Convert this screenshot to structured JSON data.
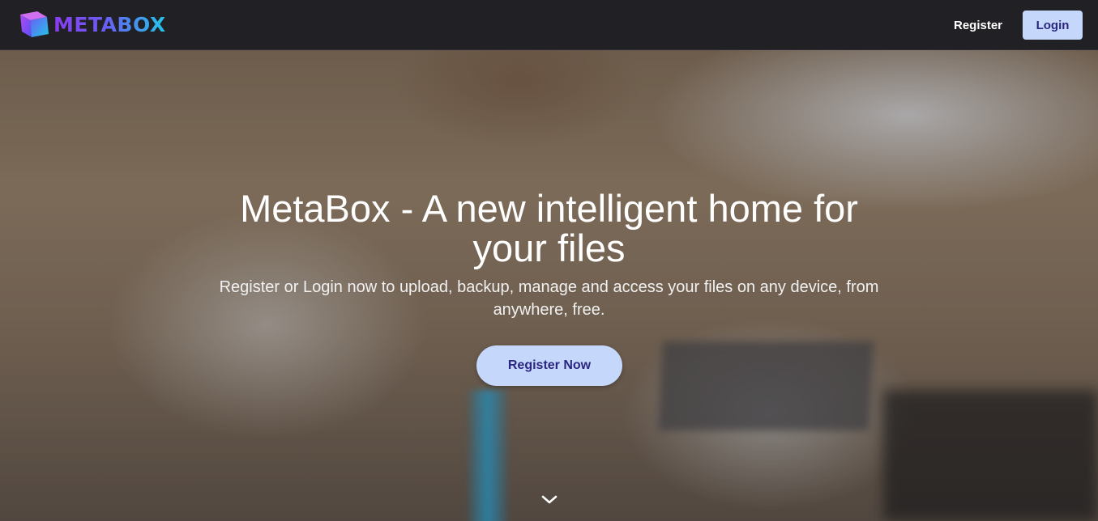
{
  "brand": {
    "name": "METABOX",
    "logo_icon": "cube-icon",
    "colors": [
      "#8a3cf0",
      "#22c6e8"
    ]
  },
  "nav": {
    "register_label": "Register",
    "login_label": "Login"
  },
  "hero": {
    "title": "MetaBox - A new intelligent home for your files",
    "subtitle": "Register or Login now to upload, backup, manage and access your files on any device, from anywhere, free.",
    "cta_label": "Register Now",
    "scroll_icon": "chevron-down-icon"
  },
  "colors": {
    "button_bg": "#c5d8fb",
    "button_text": "#2b2680",
    "navbar_bg": "#212024"
  }
}
